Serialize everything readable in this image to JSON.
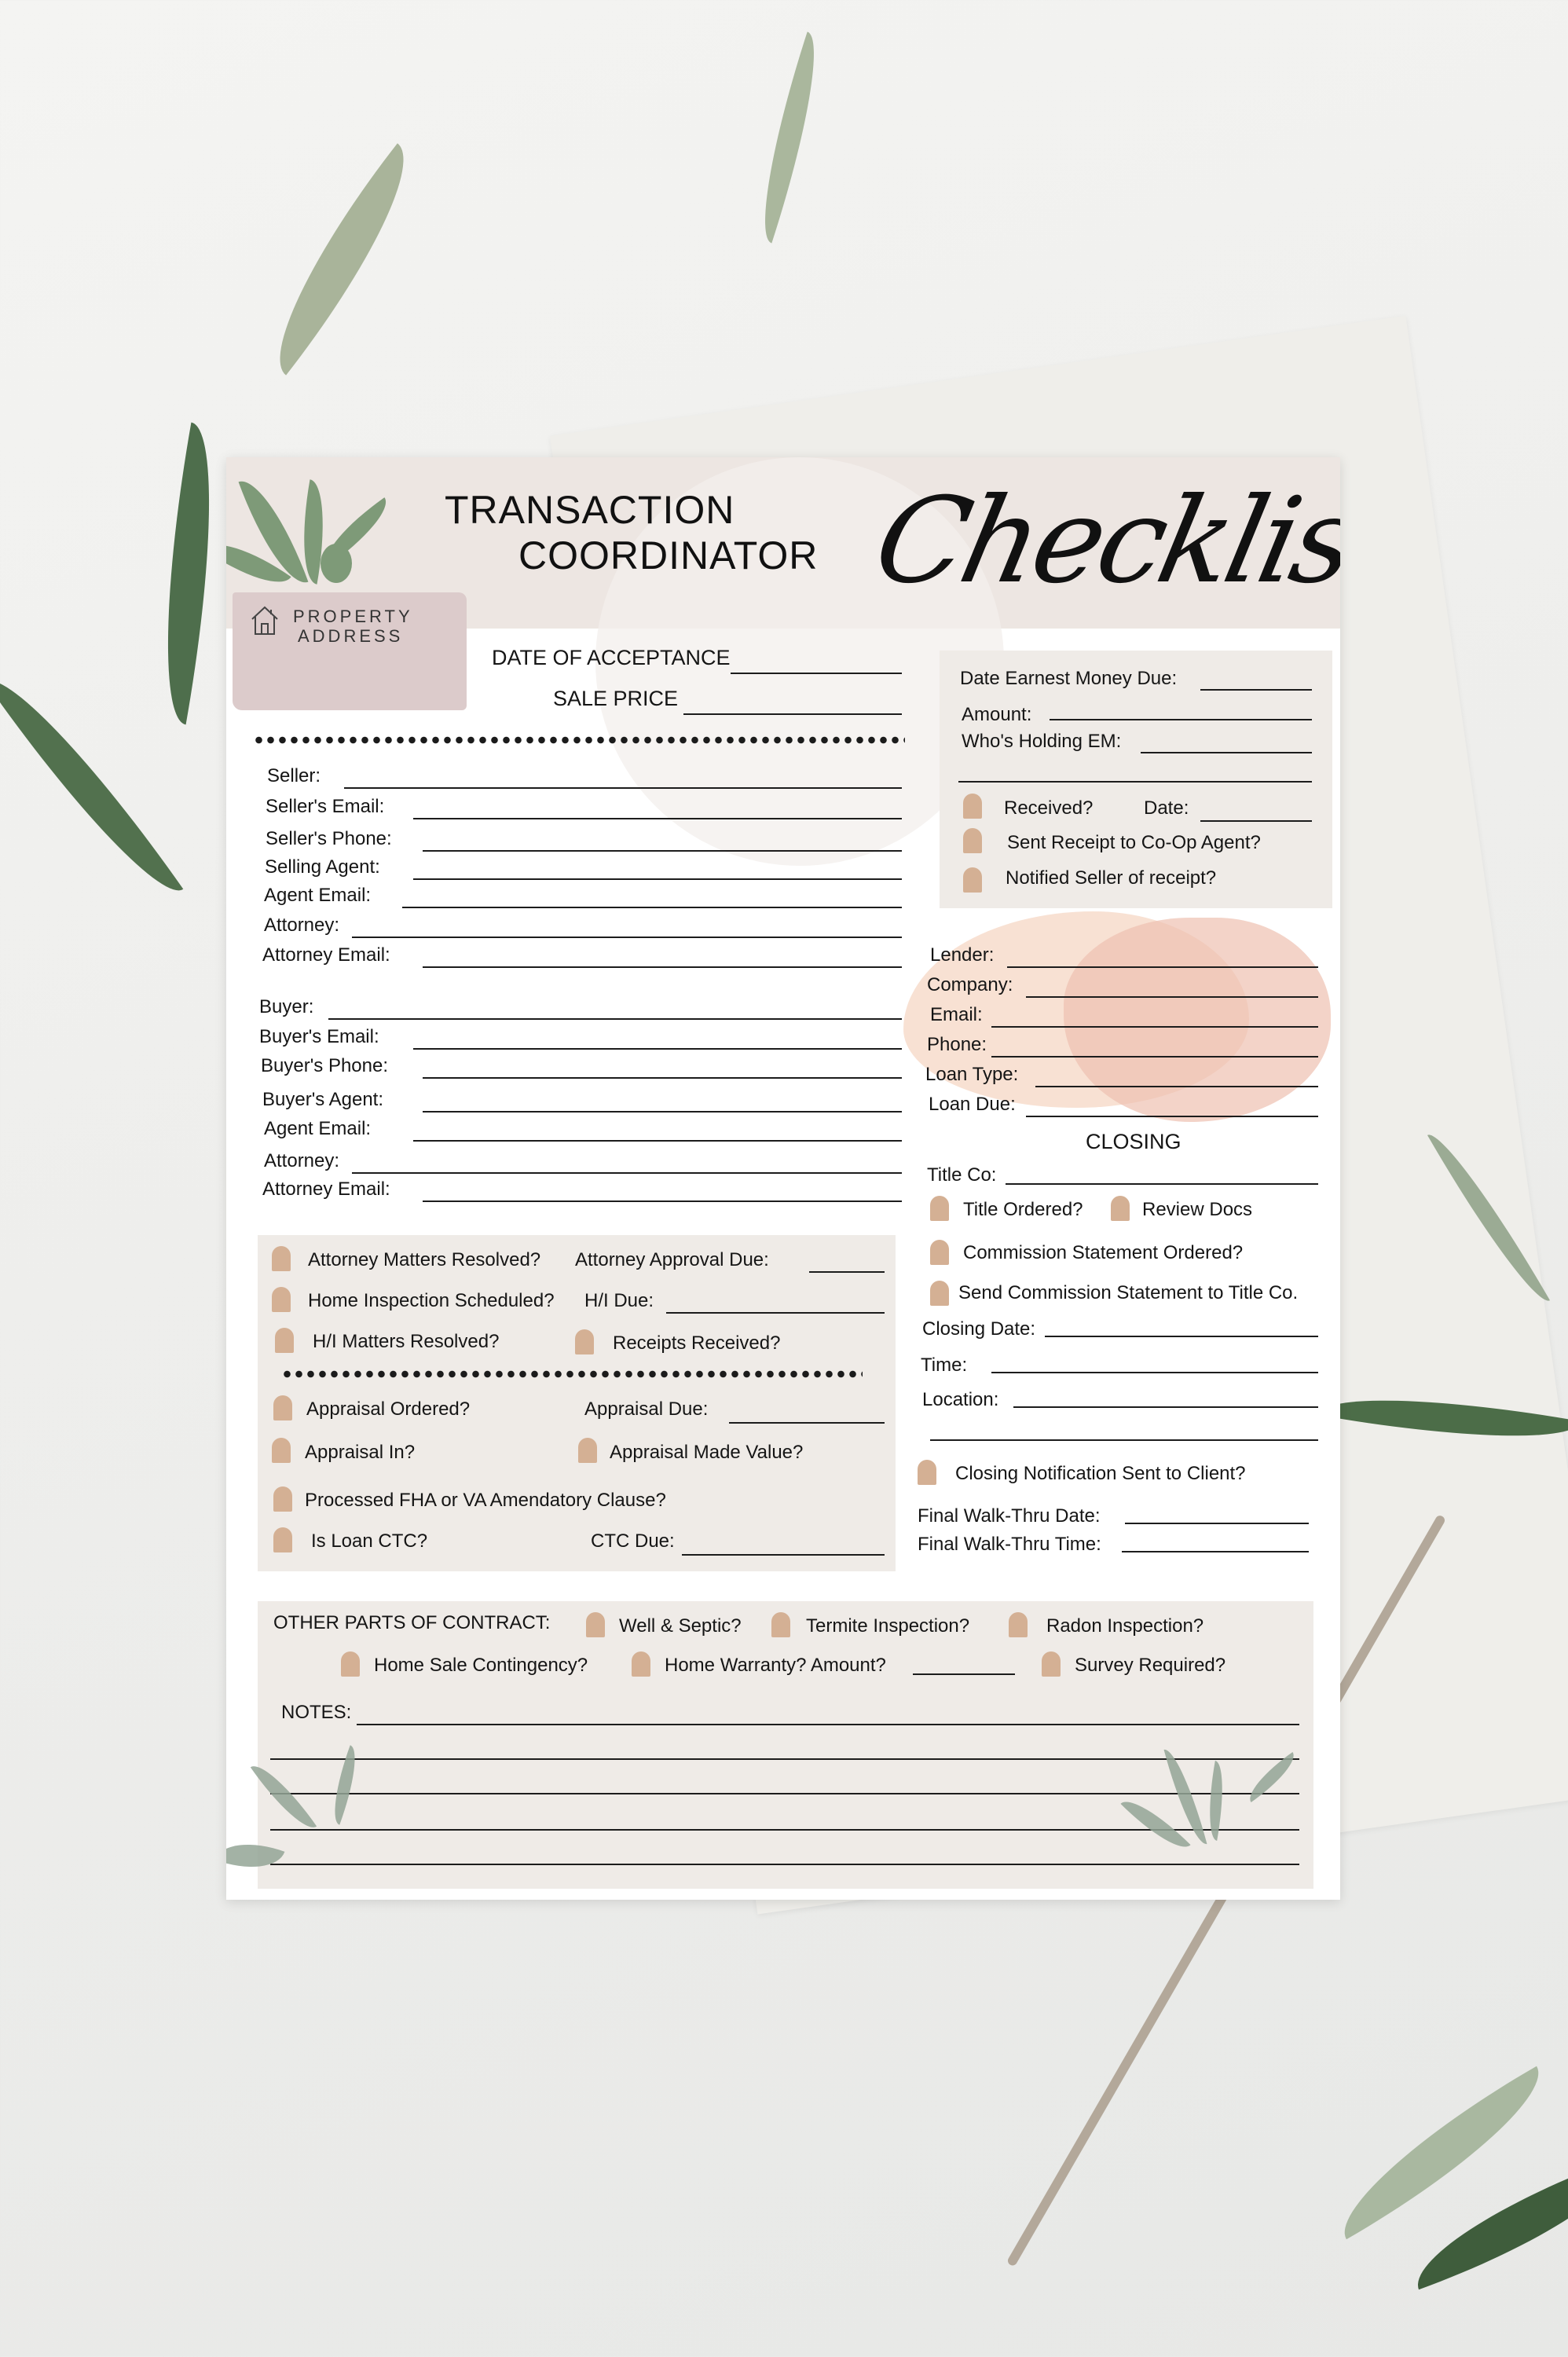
{
  "header": {
    "title_line1": "TRANSACTION",
    "title_line2": "COORDINATOR",
    "script_title": "Checklist",
    "property_line1": "PROPERTY",
    "property_line2": "ADDRESS",
    "property_icon": "house-icon"
  },
  "top_fields": {
    "date_of_acceptance": "DATE OF ACCEPTANCE",
    "sale_price": "SALE PRICE"
  },
  "seller_fields": [
    "Seller:",
    "Seller's Email:",
    "Seller's Phone:",
    "Selling Agent:",
    "Agent Email:",
    "Attorney:",
    "Attorney Email:"
  ],
  "buyer_fields": [
    "Buyer:",
    "Buyer's Email:",
    "Buyer's Phone:",
    "Buyer's Agent:",
    "Agent Email:",
    "Attorney:",
    "Attorney Email:"
  ],
  "earnest_money": {
    "date_due": "Date Earnest Money Due:",
    "amount": "Amount:",
    "holder": "Who's Holding EM:",
    "received": "Received?",
    "date": "Date:",
    "sent_receipt": "Sent Receipt to Co-Op Agent?",
    "notified_seller": "Notified Seller of receipt?"
  },
  "lender": {
    "fields": [
      "Lender:",
      "Company:",
      "Email:",
      "Phone:",
      "Loan Type:",
      "Loan Due:"
    ]
  },
  "closing": {
    "heading": "CLOSING",
    "title_co": "Title Co:",
    "title_ordered": "Title Ordered?",
    "review_docs": "Review Docs",
    "commission_ordered": "Commission Statement Ordered?",
    "send_commission": "Send Commission Statement to Title Co.",
    "closing_date": "Closing Date:",
    "time": "Time:",
    "location": "Location:",
    "notification": "Closing Notification Sent to Client?",
    "walk_date": "Final Walk-Thru Date:",
    "walk_time": "Final Walk-Thru Time:"
  },
  "checklist": {
    "attorney_resolved": "Attorney Matters Resolved?",
    "attorney_due": "Attorney Approval Due:",
    "inspection_scheduled": "Home Inspection Scheduled?",
    "hi_due": "H/I Due:",
    "hi_resolved": "H/I Matters Resolved?",
    "receipts": "Receipts Received?",
    "appraisal_ordered": "Appraisal Ordered?",
    "appraisal_due": "Appraisal Due:",
    "appraisal_in": "Appraisal In?",
    "appraisal_value": "Appraisal Made Value?",
    "fha_va": "Processed FHA or VA Amendatory Clause?",
    "loan_ctc": "Is Loan CTC?",
    "ctc_due": "CTC Due:"
  },
  "contract": {
    "heading": "OTHER PARTS OF CONTRACT:",
    "well_septic": "Well & Septic?",
    "termite": "Termite Inspection?",
    "radon": "Radon Inspection?",
    "home_sale": "Home Sale Contingency?",
    "warranty": "Home Warranty? Amount?",
    "survey": "Survey Required?",
    "notes": "NOTES:"
  },
  "colors": {
    "header_band": "#ede6e2",
    "property_box": "#dccbcb",
    "panel": "#efebe7",
    "checkbox": "#d4b094",
    "leaf": "#7e9a78",
    "blob_peach": "#f7dccb",
    "blob_rose": "#eec1b1"
  }
}
